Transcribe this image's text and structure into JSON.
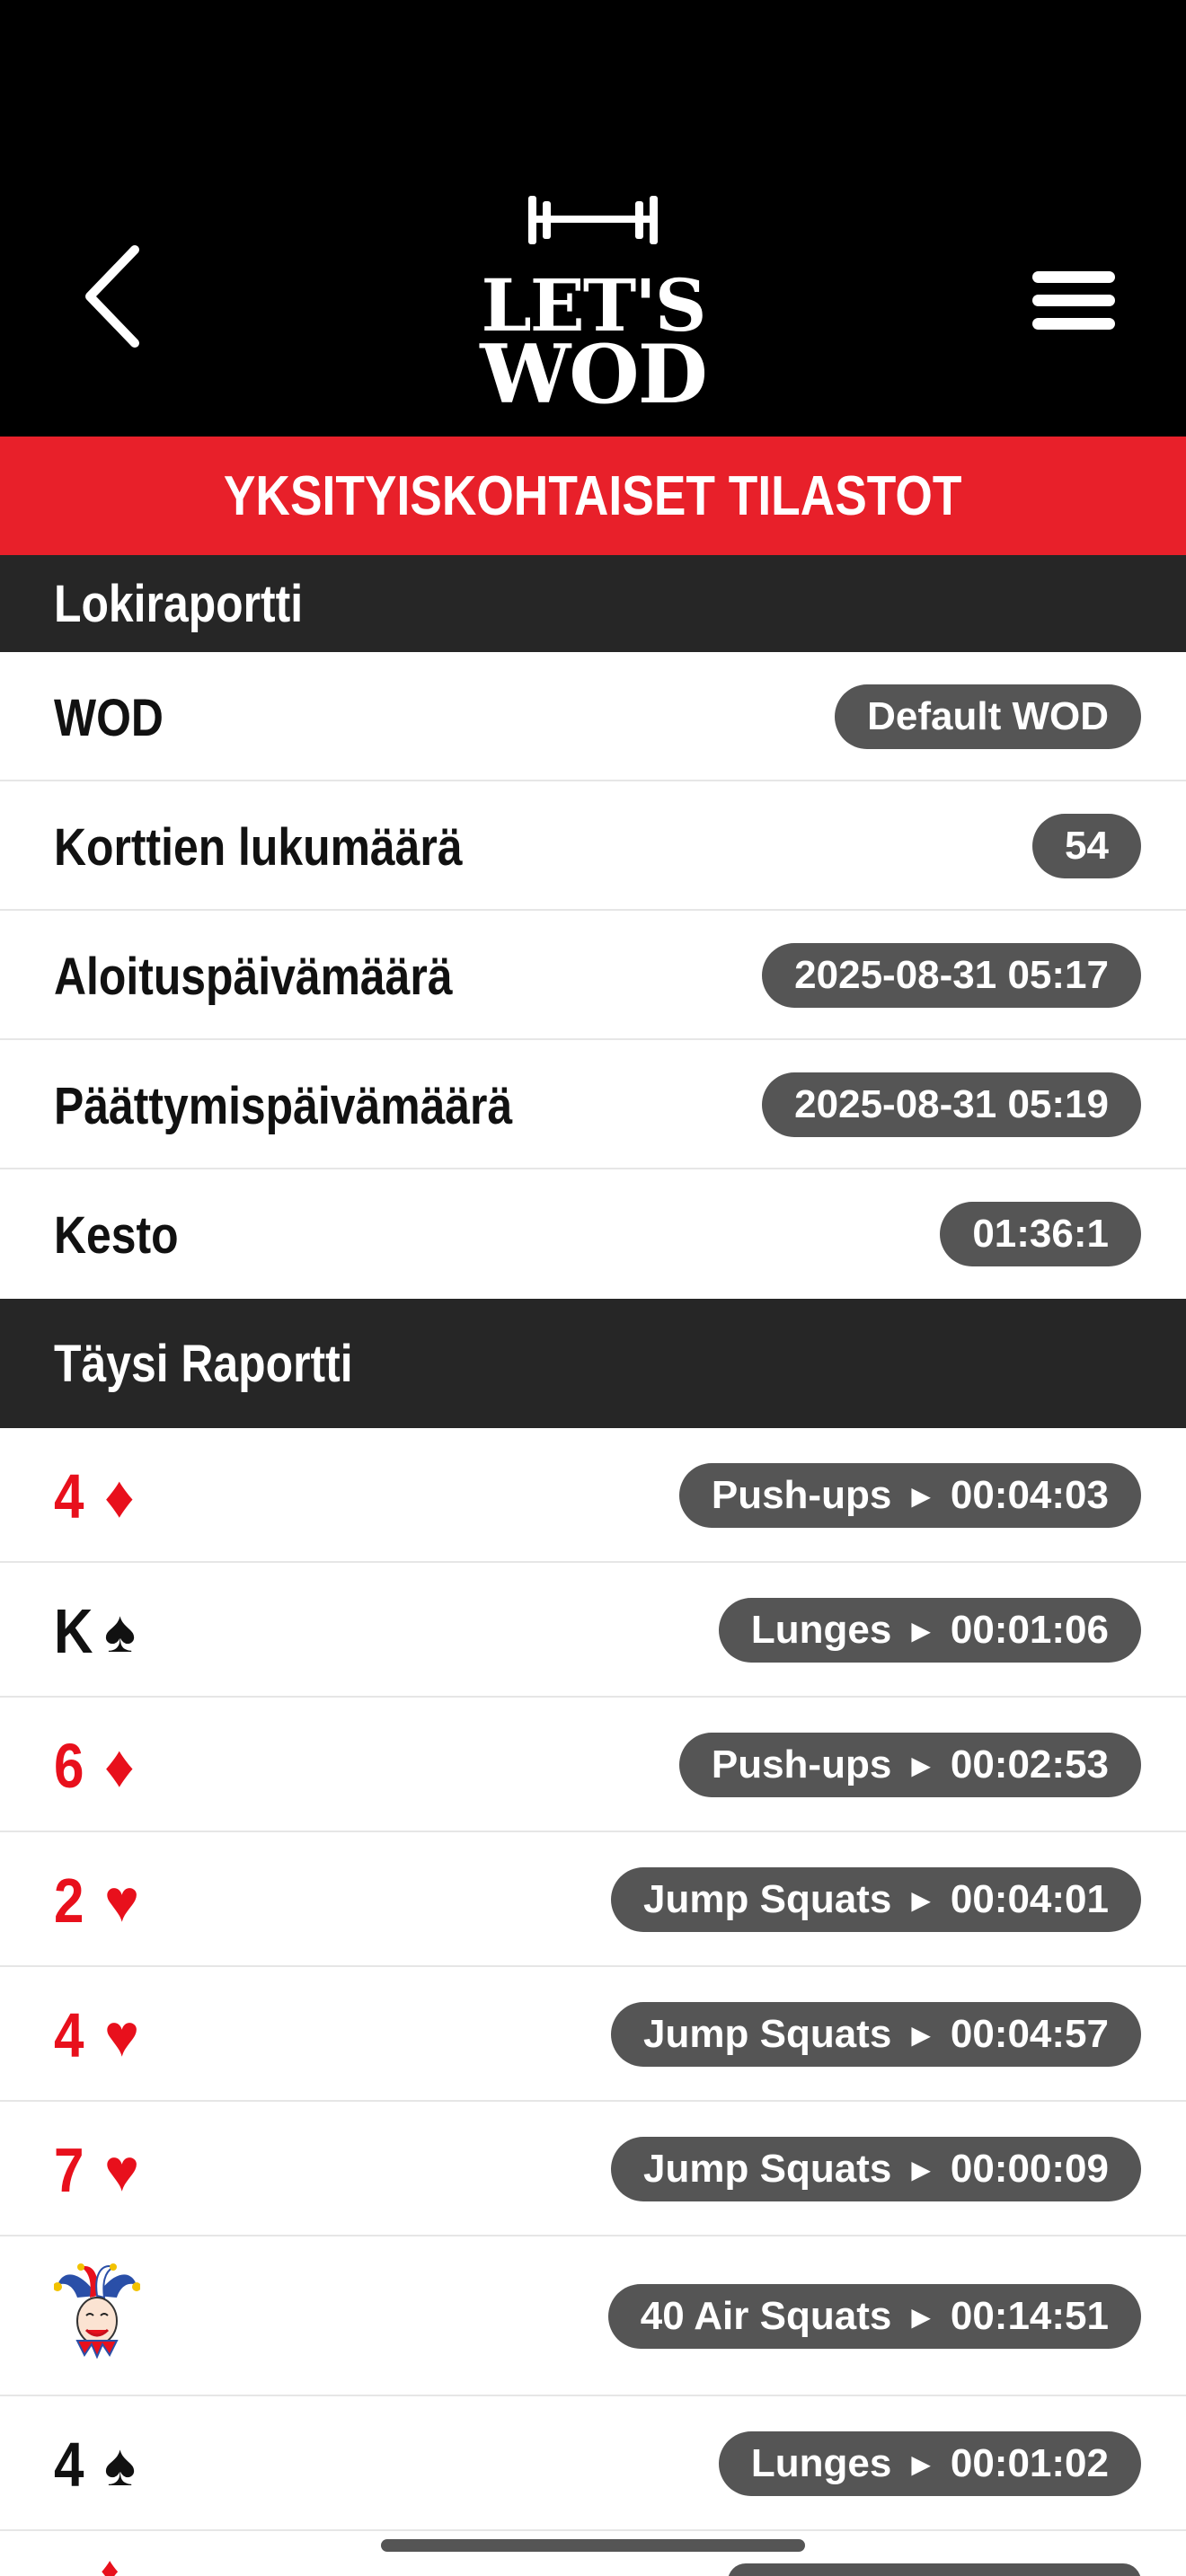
{
  "header": {
    "logo_line1": "LET'S",
    "logo_line2": "WOD",
    "back_icon": "chevron-left-icon",
    "menu_icon": "hamburger-menu-icon"
  },
  "banner": {
    "title": "YKSITYISKOHTAISET TILASTOT"
  },
  "log_report": {
    "title": "Lokiraportti",
    "rows": [
      {
        "label": "WOD",
        "value": "Default WOD"
      },
      {
        "label": "Korttien lukumäärä",
        "value": "54"
      },
      {
        "label": "Aloituspäivämäärä",
        "value": "2025-08-31 05:17"
      },
      {
        "label": "Päättymispäivämäärä",
        "value": "2025-08-31 05:19"
      },
      {
        "label": "Kesto",
        "value": "01:36:1"
      }
    ]
  },
  "full_report": {
    "title": "Täysi Raportti",
    "cards": [
      {
        "rank": "4",
        "suit": "♦",
        "color": "red",
        "exercise": "Push-ups",
        "time": "00:04:03"
      },
      {
        "rank": "K",
        "suit": "♠",
        "color": "black",
        "exercise": "Lunges",
        "time": "00:01:06"
      },
      {
        "rank": "6",
        "suit": "♦",
        "color": "red",
        "exercise": "Push-ups",
        "time": "00:02:53"
      },
      {
        "rank": "2",
        "suit": "♥",
        "color": "red",
        "exercise": "Jump Squats",
        "time": "00:04:01"
      },
      {
        "rank": "4",
        "suit": "♥",
        "color": "red",
        "exercise": "Jump Squats",
        "time": "00:04:57"
      },
      {
        "rank": "7",
        "suit": "♥",
        "color": "red",
        "exercise": "Jump Squats",
        "time": "00:00:09"
      },
      {
        "rank": "",
        "suit": "joker",
        "color": "joker",
        "exercise": "40 Air Squats",
        "time": "00:14:51"
      },
      {
        "rank": "4",
        "suit": "♠",
        "color": "black",
        "exercise": "Lunges",
        "time": "00:01:02"
      }
    ]
  },
  "colors": {
    "header_bg": "#000000",
    "banner_red": "#e8202a",
    "section_dark": "#262626",
    "pill_gray": "#555555",
    "suit_red": "#e8101c"
  }
}
